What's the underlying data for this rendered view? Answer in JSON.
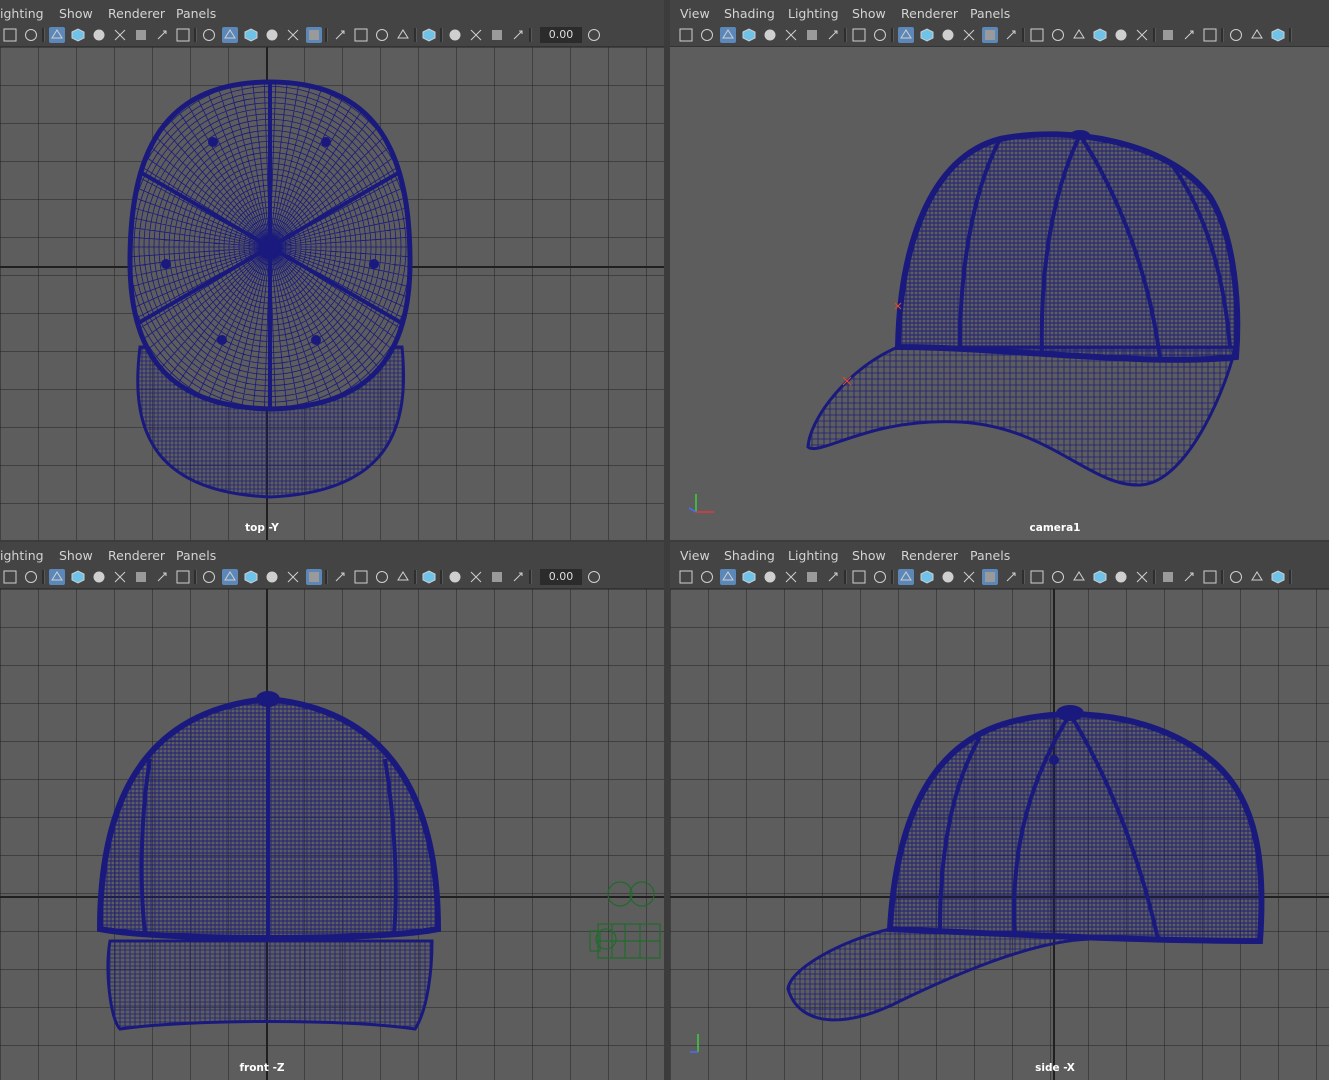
{
  "menus_left": [
    "ighting",
    "Show",
    "Renderer",
    "Panels"
  ],
  "menus_right": [
    "View",
    "Shading",
    "Lighting",
    "Show",
    "Renderer",
    "Panels"
  ],
  "viewports": {
    "top": {
      "label": "top -Y",
      "value": "0.00"
    },
    "persp": {
      "label": "camera1"
    },
    "front": {
      "label": "front -Z",
      "value": "0.00"
    },
    "side": {
      "label": "side -X"
    }
  },
  "colors": {
    "wire": "#1a1a7e",
    "background": "#5d5d5d",
    "camera_wire": "#1f6b2a",
    "toolbar_active": "#5b88b8"
  },
  "icons": [
    "select-icon",
    "paint-icon",
    "grid-icon",
    "film-gate-icon",
    "resolution-gate-icon",
    "shading-icon",
    "wireframe-icon",
    "smooth-shade-icon",
    "textured-icon",
    "lights-icon",
    "shadows-icon",
    "isolate-icon",
    "xray-icon",
    "camera-icon",
    "exposure-icon",
    "gamma-icon"
  ]
}
